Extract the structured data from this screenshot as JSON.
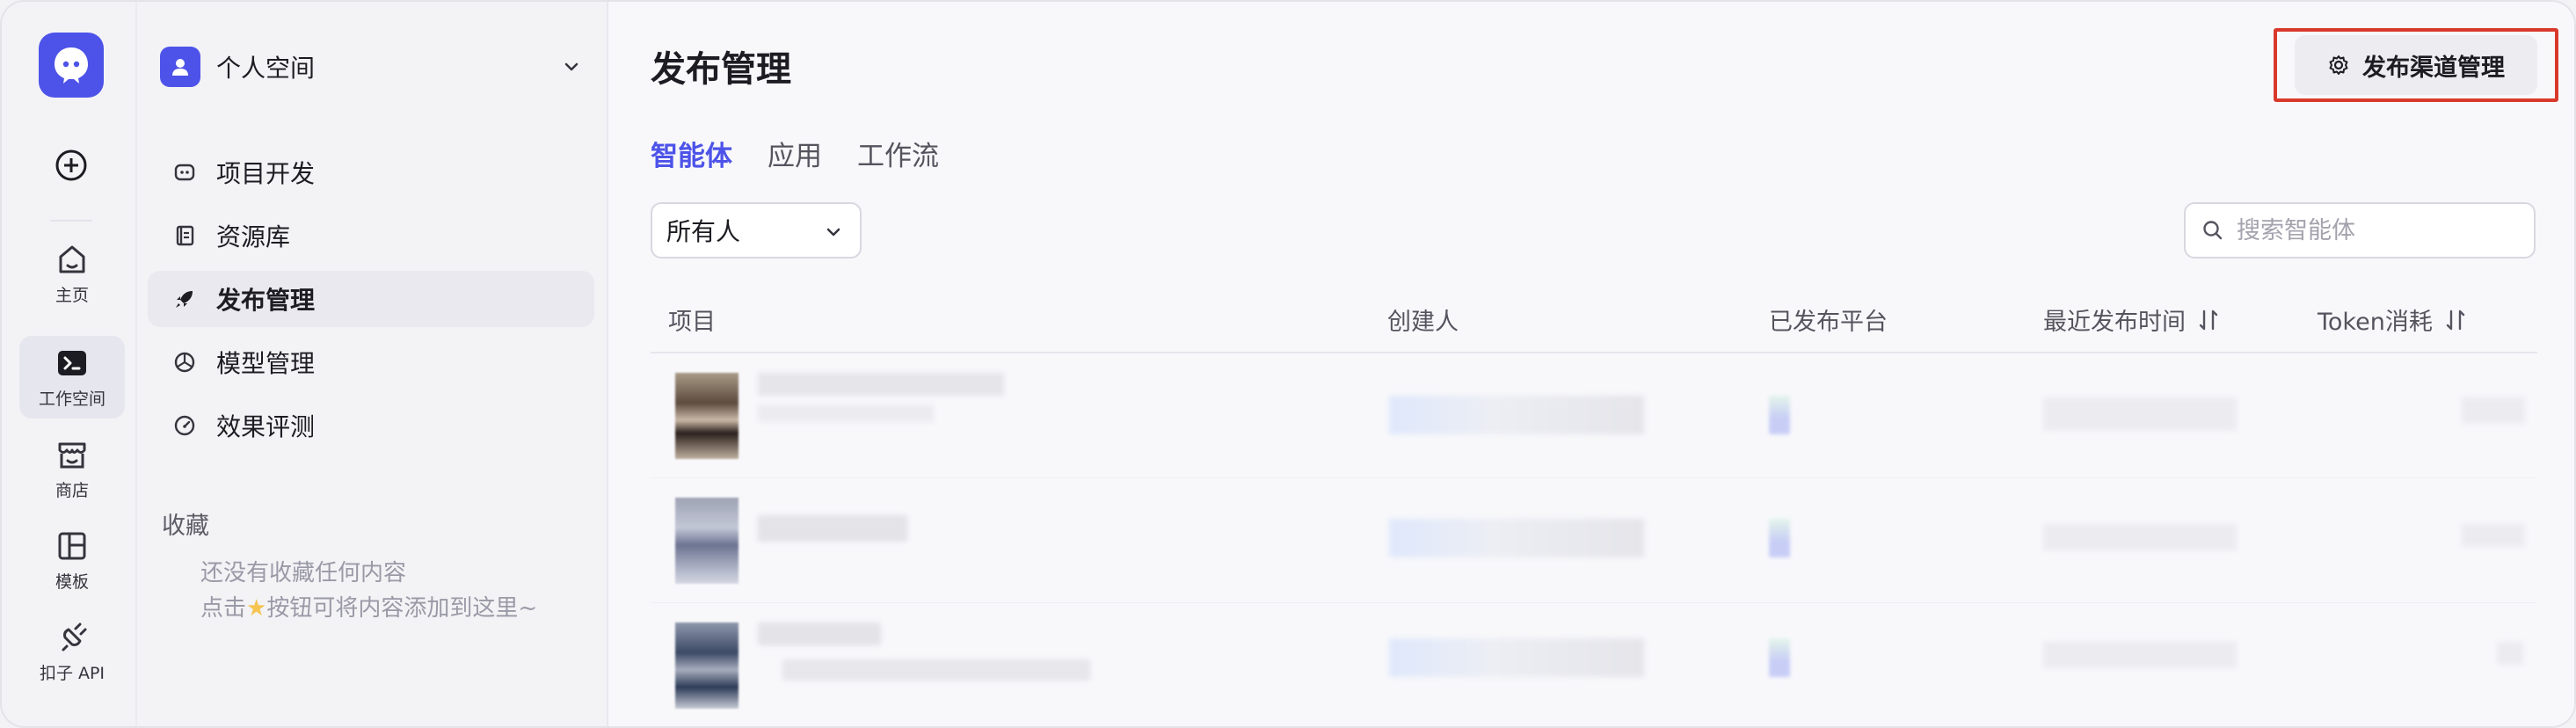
{
  "rail": {
    "items": [
      {
        "label": "主页",
        "icon": "home-icon"
      },
      {
        "label": "工作空间",
        "icon": "terminal-icon",
        "active": true
      },
      {
        "label": "商店",
        "icon": "store-icon"
      },
      {
        "label": "模板",
        "icon": "template-icon"
      },
      {
        "label": "扣子 API",
        "icon": "api-plug-icon"
      }
    ]
  },
  "sidebar": {
    "space_name": "个人空间",
    "nav": [
      {
        "label": "项目开发",
        "icon": "robot-icon"
      },
      {
        "label": "资源库",
        "icon": "library-icon"
      },
      {
        "label": "发布管理",
        "icon": "rocket-icon",
        "active": true
      },
      {
        "label": "模型管理",
        "icon": "model-icon"
      },
      {
        "label": "效果评测",
        "icon": "gauge-icon"
      }
    ],
    "favorites_title": "收藏",
    "favorites_empty_line1": "还没有收藏任何内容",
    "favorites_empty_line2_prefix": "点击",
    "favorites_empty_line2_suffix": "按钮可将内容添加到这里~"
  },
  "main": {
    "title": "发布管理",
    "channel_button": "发布渠道管理",
    "tabs": [
      "智能体",
      "应用",
      "工作流"
    ],
    "active_tab": "智能体",
    "owner_filter": "所有人",
    "search_placeholder": "搜索智能体",
    "columns": [
      "项目",
      "创建人",
      "已发布平台",
      "最近发布时间",
      "Token消耗"
    ]
  },
  "colors": {
    "accent": "#4d53e8",
    "highlight": "#d8392b"
  }
}
